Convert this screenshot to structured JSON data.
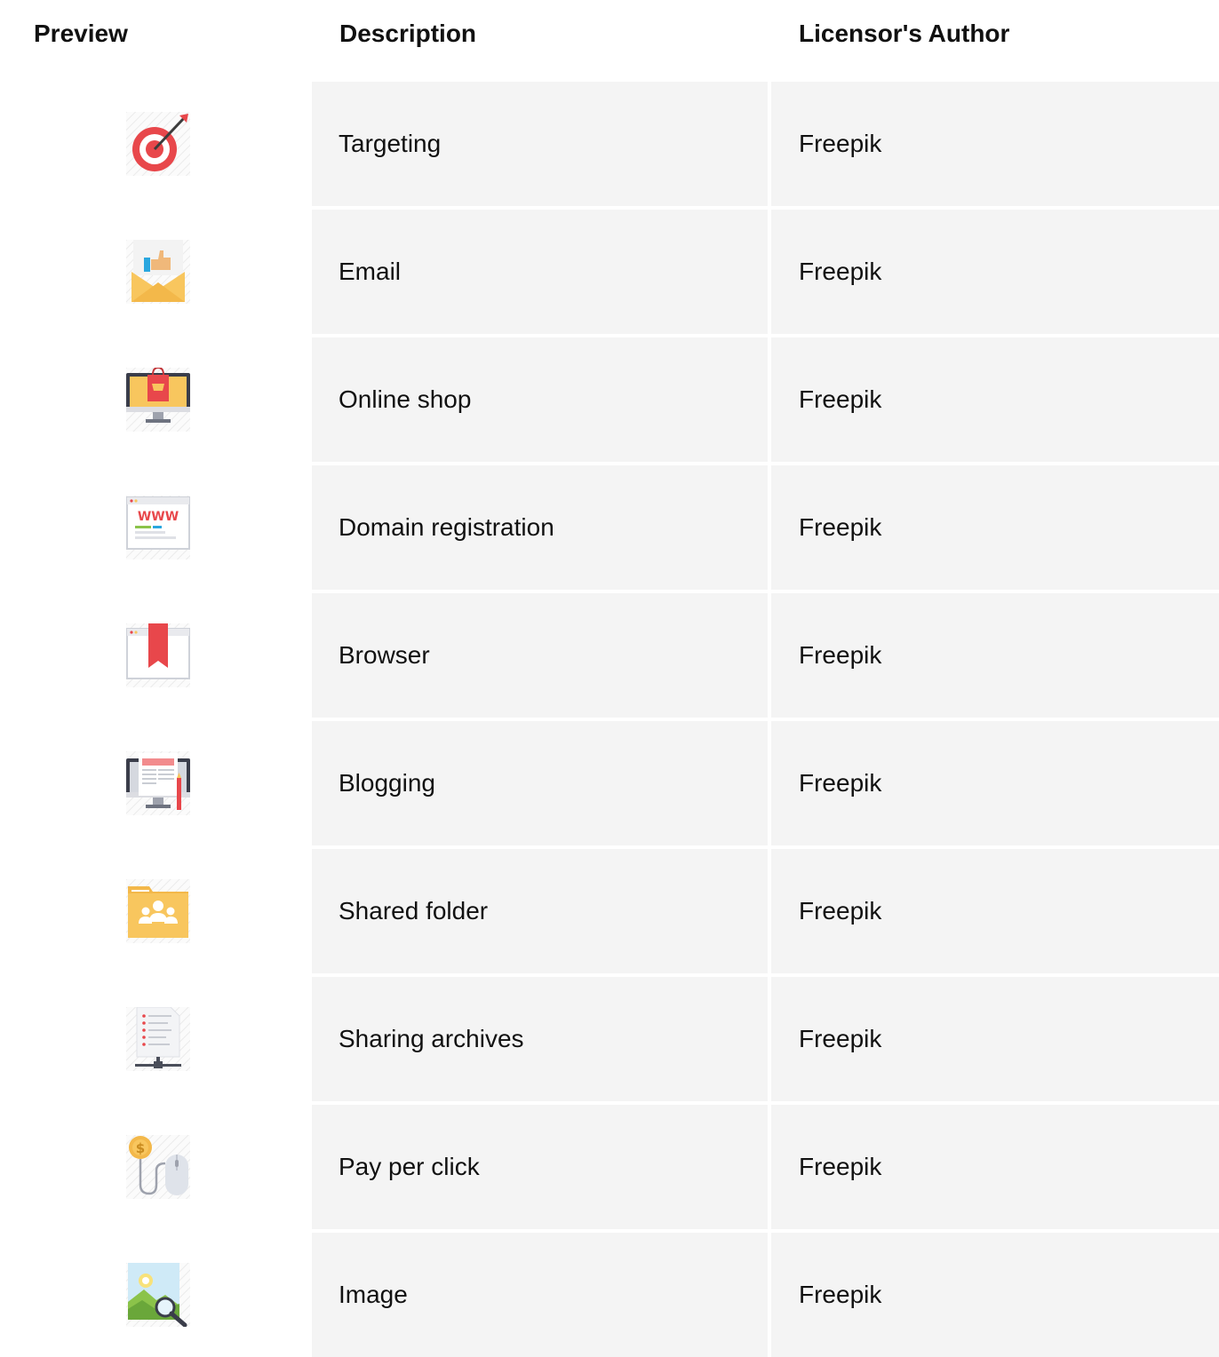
{
  "header": {
    "preview": "Preview",
    "description": "Description",
    "author": "Licensor's Author"
  },
  "rows": [
    {
      "icon": "target-icon",
      "description": "Targeting",
      "author": "Freepik"
    },
    {
      "icon": "email-icon",
      "description": "Email",
      "author": "Freepik"
    },
    {
      "icon": "online-shop-icon",
      "description": "Online shop",
      "author": "Freepik"
    },
    {
      "icon": "domain-registration-icon",
      "description": "Domain registration",
      "author": "Freepik"
    },
    {
      "icon": "browser-icon",
      "description": "Browser",
      "author": "Freepik"
    },
    {
      "icon": "blogging-icon",
      "description": "Blogging",
      "author": "Freepik"
    },
    {
      "icon": "shared-folder-icon",
      "description": "Shared folder",
      "author": "Freepik"
    },
    {
      "icon": "sharing-archives-icon",
      "description": "Sharing archives",
      "author": "Freepik"
    },
    {
      "icon": "pay-per-click-icon",
      "description": "Pay per click",
      "author": "Freepik"
    },
    {
      "icon": "image-icon",
      "description": "Image",
      "author": "Freepik"
    }
  ]
}
